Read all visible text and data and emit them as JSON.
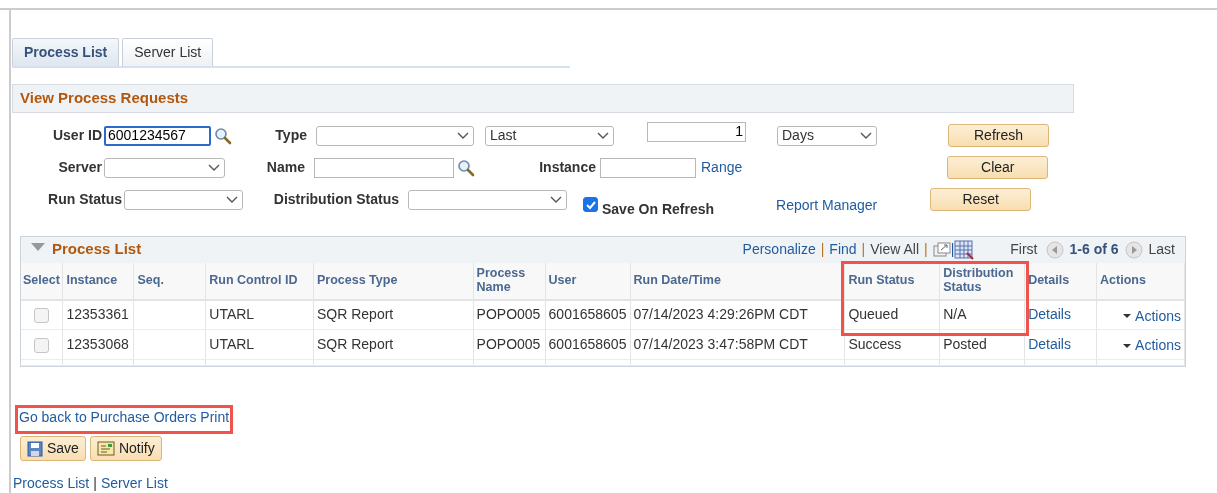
{
  "tabs": [
    {
      "label": "Process List",
      "selected": true
    },
    {
      "label": "Server List",
      "selected": false
    }
  ],
  "section_title": "View Process Requests",
  "filters": {
    "user_id": {
      "label": "User ID",
      "value": "6001234567",
      "focused": true
    },
    "type": {
      "label": "Type"
    },
    "period": {
      "value": "Last"
    },
    "count": {
      "value": "1"
    },
    "unit": {
      "value": "Days"
    },
    "server": {
      "label": "Server"
    },
    "name": {
      "label": "Name"
    },
    "instance": {
      "label": "Instance",
      "link": "Range"
    },
    "run_status": {
      "label": "Run Status"
    },
    "distribution_status": {
      "label": "Distribution Status"
    },
    "save_on_refresh": {
      "label": "Save On Refresh",
      "checked": true
    },
    "report_manager": "Report Manager"
  },
  "buttons": [
    "Refresh",
    "Clear",
    "Reset"
  ],
  "process_list": {
    "title": "Process List",
    "expanded": true,
    "toolbar": [
      "Personalize",
      "|",
      "Find",
      "|",
      "View All",
      "|",
      "|"
    ],
    "first": "First",
    "range": "1-6 of 6",
    "last": "Last",
    "columns": [
      {
        "label": "Select",
        "kind": "select",
        "highlighted": false
      },
      {
        "label": "Instance",
        "kind": "text",
        "highlighted": false
      },
      {
        "label": "Seq.",
        "kind": "text",
        "highlighted": false
      },
      {
        "label": "Run Control ID",
        "kind": "text",
        "highlighted": false
      },
      {
        "label": "Process Type",
        "kind": "text",
        "highlighted": false
      },
      {
        "label": "Process Name",
        "kind": "text",
        "highlighted": false
      },
      {
        "label": "User",
        "kind": "text",
        "highlighted": false
      },
      {
        "label": "Run Date/Time",
        "kind": "text",
        "highlighted": false
      },
      {
        "label": "Run Status",
        "kind": "text",
        "highlighted": true
      },
      {
        "label": "Distribution Status",
        "kind": "text",
        "highlighted": true
      },
      {
        "label": "Details",
        "kind": "link",
        "highlighted": false
      },
      {
        "label": "Actions",
        "kind": "menu",
        "highlighted": false
      }
    ],
    "rows": [
      {
        "checked": false,
        "highlighted": true,
        "cells": [
          "",
          "12353361",
          "",
          "UTARL",
          "SQR Report",
          "POPO005",
          "6001658605",
          "07/14/2023  4:29:26PM CDT",
          "Queued",
          "N/A",
          "Details",
          "Actions"
        ]
      },
      {
        "checked": false,
        "highlighted": false,
        "cells": [
          "",
          "12353068",
          "",
          "UTARL",
          "SQR Report",
          "POPO005",
          "6001658605",
          "07/14/2023  3:47:58PM CDT",
          "Success",
          "Posted",
          "Details",
          "Actions"
        ]
      }
    ]
  },
  "back_link": {
    "label": "Go back to Purchase Orders Print",
    "highlighted": true
  },
  "page_buttons": [
    {
      "kind": "save",
      "label": "Save"
    },
    {
      "kind": "notify",
      "label": "Notify"
    }
  ],
  "footer_links": [
    "Process List",
    "|",
    "Server List"
  ]
}
